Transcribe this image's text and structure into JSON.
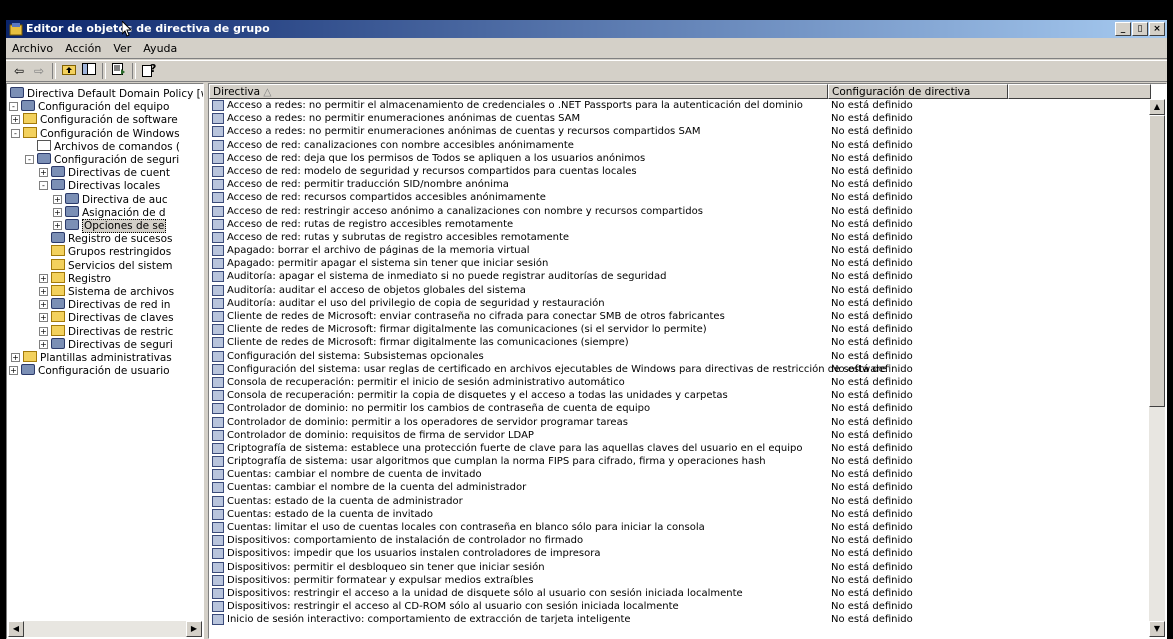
{
  "window": {
    "title": "Editor de objetos de directiva de grupo",
    "buttons": [
      "_",
      "▯",
      "×"
    ]
  },
  "menu": [
    "Archivo",
    "Acción",
    "Ver",
    "Ayuda"
  ],
  "tree": [
    {
      "label": "Directiva Default Domain Policy [we",
      "level": 0,
      "expander": "",
      "icon": "gear"
    },
    {
      "label": "Configuración del equipo",
      "level": 0,
      "expander": "-",
      "icon": "gear"
    },
    {
      "label": "Configuración de software",
      "level": 1,
      "expander": "+",
      "icon": "folder"
    },
    {
      "label": "Configuración de Windows",
      "level": 1,
      "expander": "-",
      "icon": "folder"
    },
    {
      "label": "Archivos de comandos (",
      "level": 2,
      "expander": "",
      "icon": "doc"
    },
    {
      "label": "Configuración de seguri",
      "level": 2,
      "expander": "-",
      "icon": "gear"
    },
    {
      "label": "Directivas de cuent",
      "level": 3,
      "expander": "+",
      "icon": "gear"
    },
    {
      "label": "Directivas locales",
      "level": 3,
      "expander": "-",
      "icon": "gear"
    },
    {
      "label": "Directiva de auc",
      "level": 4,
      "expander": "+",
      "icon": "gear"
    },
    {
      "label": "Asignación de d",
      "level": 4,
      "expander": "+",
      "icon": "gear"
    },
    {
      "label": "Opciones de se",
      "level": 4,
      "expander": "+",
      "icon": "gear",
      "selected": true
    },
    {
      "label": "Registro de sucesos",
      "level": 3,
      "expander": "",
      "icon": "gear"
    },
    {
      "label": "Grupos restringidos",
      "level": 3,
      "expander": "",
      "icon": "folder"
    },
    {
      "label": "Servicios del sistem",
      "level": 3,
      "expander": "",
      "icon": "folder"
    },
    {
      "label": "Registro",
      "level": 3,
      "expander": "+",
      "icon": "folder"
    },
    {
      "label": "Sistema de archivos",
      "level": 3,
      "expander": "+",
      "icon": "folder"
    },
    {
      "label": "Directivas de red in",
      "level": 3,
      "expander": "+",
      "icon": "gear"
    },
    {
      "label": "Directivas de claves",
      "level": 3,
      "expander": "+",
      "icon": "folder"
    },
    {
      "label": "Directivas de restric",
      "level": 3,
      "expander": "+",
      "icon": "folder"
    },
    {
      "label": "Directivas de seguri",
      "level": 3,
      "expander": "+",
      "icon": "gear"
    },
    {
      "label": "Plantillas administrativas",
      "level": 1,
      "expander": "+",
      "icon": "folder"
    },
    {
      "label": "Configuración de usuario",
      "level": 0,
      "expander": "+",
      "icon": "gear"
    }
  ],
  "columns": {
    "policy": "Directiva",
    "setting": "Configuración de directiva"
  },
  "policies": [
    {
      "name": "Acceso a redes: no permitir el almacenamiento de  credenciales o .NET Passports para la autenticación del dominio",
      "value": "No está definido"
    },
    {
      "name": "Acceso a redes: no permitir enumeraciones anónimas de cuentas SAM",
      "value": "No está definido"
    },
    {
      "name": "Acceso a redes: no permitir enumeraciones anónimas de cuentas y recursos compartidos SAM",
      "value": "No está definido"
    },
    {
      "name": "Acceso de red: canalizaciones con nombre accesibles anónimamente",
      "value": "No está definido"
    },
    {
      "name": "Acceso de red: deja que los permisos de Todos se apliquen a los usuarios anónimos",
      "value": "No está definido"
    },
    {
      "name": "Acceso de red: modelo de seguridad y recursos compartidos para cuentas locales",
      "value": "No está definido"
    },
    {
      "name": "Acceso de red: permitir traducción SID/nombre anónima",
      "value": "No está definido"
    },
    {
      "name": "Acceso de red: recursos compartidos accesibles anónimamente",
      "value": "No está definido"
    },
    {
      "name": "Acceso de red: restringir acceso anónimo a canalizaciones con nombre y recursos compartidos",
      "value": "No está definido"
    },
    {
      "name": "Acceso de red: rutas de registro accesibles remotamente",
      "value": "No está definido"
    },
    {
      "name": "Acceso de red: rutas y subrutas de registro accesibles remotamente",
      "value": "No está definido"
    },
    {
      "name": "Apagado: borrar el archivo de páginas de la memoria virtual",
      "value": "No está definido"
    },
    {
      "name": "Apagado: permitir apagar el sistema sin tener que iniciar sesión",
      "value": "No está definido"
    },
    {
      "name": "Auditoría: apagar el sistema de inmediato si no puede registrar auditorías de seguridad",
      "value": "No está definido"
    },
    {
      "name": "Auditoría: auditar el acceso de objetos globales del sistema",
      "value": "No está definido"
    },
    {
      "name": "Auditoría: auditar el uso del privilegio de copia de seguridad y restauración",
      "value": "No está definido"
    },
    {
      "name": "Cliente de redes de Microsoft: enviar contraseña no cifrada para conectar SMB de otros fabricantes",
      "value": "No está definido"
    },
    {
      "name": "Cliente de redes de Microsoft: firmar digitalmente las comunicaciones (si el servidor lo permite)",
      "value": "No está definido"
    },
    {
      "name": "Cliente de redes de Microsoft: firmar digitalmente las comunicaciones (siempre)",
      "value": "No está definido"
    },
    {
      "name": "Configuración del sistema: Subsistemas opcionales",
      "value": "No está definido"
    },
    {
      "name": "Configuración del sistema: usar reglas de certificado en archivos ejecutables de Windows para directivas de restricción de software",
      "value": "No está definido"
    },
    {
      "name": "Consola de recuperación: permitir el inicio de sesión administrativo automático",
      "value": "No está definido"
    },
    {
      "name": "Consola de recuperación: permitir la copia de disquetes y el acceso a todas las unidades y carpetas",
      "value": "No está definido"
    },
    {
      "name": "Controlador de dominio: no permitir los cambios de contraseña de cuenta de equipo",
      "value": "No está definido"
    },
    {
      "name": "Controlador de dominio: permitir a los operadores de servidor programar tareas",
      "value": "No está definido"
    },
    {
      "name": "Controlador de dominio: requisitos de firma de servidor LDAP",
      "value": "No está definido"
    },
    {
      "name": "Criptografía de sistema: establece una protección fuerte de clave para las aquellas claves del usuario en el equipo",
      "value": "No está definido"
    },
    {
      "name": "Criptografía de sistema: usar algoritmos que cumplan la norma FIPS para cifrado, firma y operaciones hash",
      "value": "No está definido"
    },
    {
      "name": "Cuentas: cambiar el nombre de cuenta de invitado",
      "value": "No está definido"
    },
    {
      "name": "Cuentas: cambiar el nombre de la cuenta del administrador",
      "value": "No está definido"
    },
    {
      "name": "Cuentas: estado de la cuenta de administrador",
      "value": "No está definido"
    },
    {
      "name": "Cuentas: estado de la cuenta de invitado",
      "value": "No está definido"
    },
    {
      "name": "Cuentas: limitar el uso de cuentas locales con contraseña en blanco sólo para iniciar la consola",
      "value": "No está definido"
    },
    {
      "name": "Dispositivos: comportamiento de instalación de controlador no firmado",
      "value": "No está definido"
    },
    {
      "name": "Dispositivos: impedir que los usuarios instalen controladores de impresora",
      "value": "No está definido"
    },
    {
      "name": "Dispositivos: permitir el desbloqueo sin tener que iniciar sesión",
      "value": "No está definido"
    },
    {
      "name": "Dispositivos: permitir formatear y expulsar medios extraíbles",
      "value": "No está definido"
    },
    {
      "name": "Dispositivos: restringir el acceso a la unidad de disquete sólo al usuario con sesión iniciada localmente",
      "value": "No está definido"
    },
    {
      "name": "Dispositivos: restringir el acceso al CD-ROM sólo al usuario con sesión iniciada localmente",
      "value": "No está definido"
    },
    {
      "name": "Inicio de sesión interactivo: comportamiento de extracción de tarjeta inteligente",
      "value": "No está definido"
    }
  ]
}
